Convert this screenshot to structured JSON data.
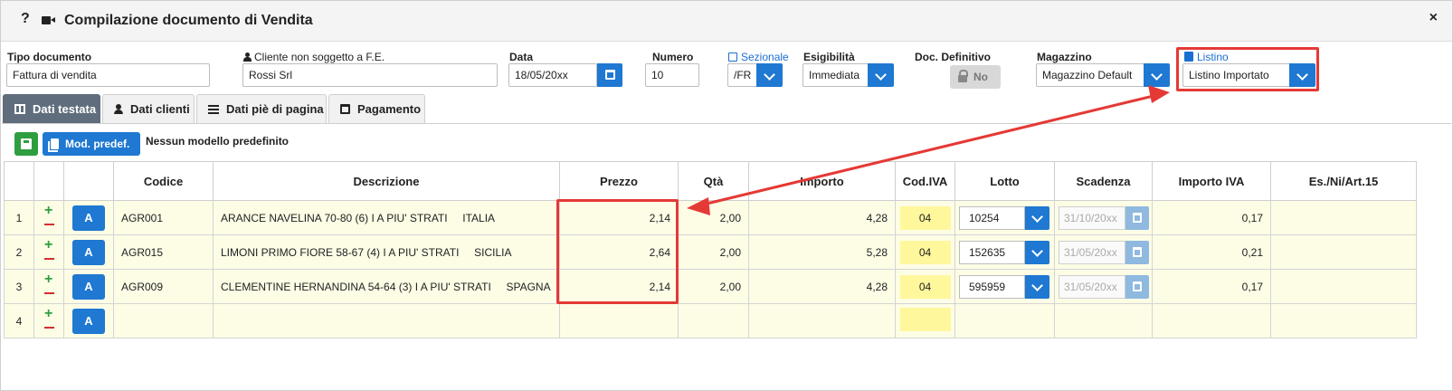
{
  "window": {
    "title": "Compilazione documento di Vendita",
    "help_label": "?",
    "close_label": "×"
  },
  "header": {
    "tipo_documento": {
      "label": "Tipo documento",
      "value": "Fattura di vendita"
    },
    "cliente": {
      "label": "Cliente non soggetto a F.E.",
      "value": "Rossi Srl"
    },
    "data": {
      "label": "Data",
      "value": "18/05/20xx"
    },
    "numero": {
      "label": "Numero",
      "value": "10"
    },
    "sezionale": {
      "label": "Sezionale",
      "value": "/FR"
    },
    "esigibilita": {
      "label": "Esigibilità",
      "value": "Immediata"
    },
    "doc_definitivo": {
      "label": "Doc. Definitivo",
      "value": "No"
    },
    "magazzino": {
      "label": "Magazzino",
      "value": "Magazzino Default"
    },
    "listino": {
      "label": "Listino",
      "value": "Listino Importato"
    }
  },
  "tabs": [
    {
      "label": "Dati testata",
      "active": true
    },
    {
      "label": "Dati clienti",
      "active": false
    },
    {
      "label": "Dati piè di pagina",
      "active": false
    },
    {
      "label": "Pagamento",
      "active": false
    }
  ],
  "toolbar": {
    "model_button_label": "Mod. predef.",
    "model_text": "Nessun modello predefinito"
  },
  "table": {
    "columns": [
      "Codice",
      "Descrizione",
      "Prezzo",
      "Qtà",
      "Importo",
      "Cod.IVA",
      "Lotto",
      "Scadenza",
      "Importo IVA",
      "Es./Ni/Art.15"
    ],
    "rows": [
      {
        "n": "1",
        "plus": "+",
        "a": "A",
        "codice": "AGR001",
        "descrizione": "ARANCE NAVELINA 70-80 (6) I A PIU' STRATI     ITALIA",
        "prezzo": "2,14",
        "qta": "2,00",
        "importo": "4,28",
        "iva": "04",
        "lotto": "10254",
        "scadenza": "31/10/20xx",
        "importo_iva": "0,17"
      },
      {
        "n": "2",
        "plus": "+",
        "a": "A",
        "codice": "AGR015",
        "descrizione": "LIMONI PRIMO FIORE 58-67 (4) I A PIU' STRATI     SICILIA",
        "prezzo": "2,64",
        "qta": "2,00",
        "importo": "5,28",
        "iva": "04",
        "lotto": "152635",
        "scadenza": "31/05/20xx",
        "importo_iva": "0,21"
      },
      {
        "n": "3",
        "plus": "+",
        "a": "A",
        "codice": "AGR009",
        "descrizione": "CLEMENTINE HERNANDINA 54-64 (3) I A PIU' STRATI     SPAGNA",
        "prezzo": "2,14",
        "qta": "2,00",
        "importo": "4,28",
        "iva": "04",
        "lotto": "595959",
        "scadenza": "31/05/20xx",
        "importo_iva": "0,17"
      },
      {
        "n": "4",
        "plus": "+",
        "a": "A",
        "codice": "",
        "descrizione": "",
        "prezzo": "",
        "qta": "",
        "importo": "",
        "iva": "",
        "lotto": "",
        "scadenza": "",
        "importo_iva": ""
      }
    ]
  },
  "colors": {
    "accent": "#1f78d1",
    "save": "#2e9e3f",
    "active_tab": "#5f6d7c",
    "row_bg": "#fdfde6",
    "iva_bg": "#fff79c",
    "highlight": "#e53935"
  }
}
